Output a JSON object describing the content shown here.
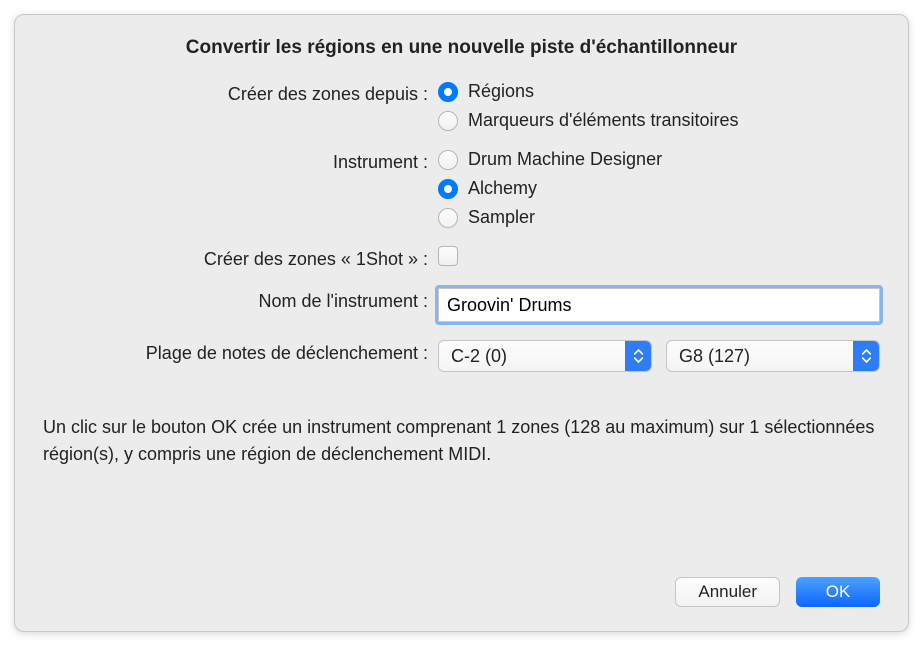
{
  "title": "Convertir les régions en une nouvelle piste d'échantillonneur",
  "createZones": {
    "label": "Créer des zones depuis :",
    "options": {
      "regions": "Régions",
      "transients": "Marqueurs d'éléments transitoires"
    },
    "selected": "regions"
  },
  "instrument": {
    "label": "Instrument :",
    "options": {
      "dmd": "Drum Machine Designer",
      "alchemy": "Alchemy",
      "sampler": "Sampler"
    },
    "selected": "alchemy"
  },
  "oneShot": {
    "label": "Créer des zones « 1Shot » :",
    "checked": false
  },
  "instrumentName": {
    "label": "Nom de l'instrument :",
    "value": "Groovin' Drums"
  },
  "triggerRange": {
    "label": "Plage de notes de déclenchement :",
    "low": "C-2  (0)",
    "high": "G8   (127)"
  },
  "info": "Un clic sur le bouton OK crée un instrument comprenant 1 zones (128 au maximum) sur 1 sélectionnées région(s), y compris une région de déclenchement MIDI.",
  "buttons": {
    "cancel": "Annuler",
    "ok": "OK"
  }
}
